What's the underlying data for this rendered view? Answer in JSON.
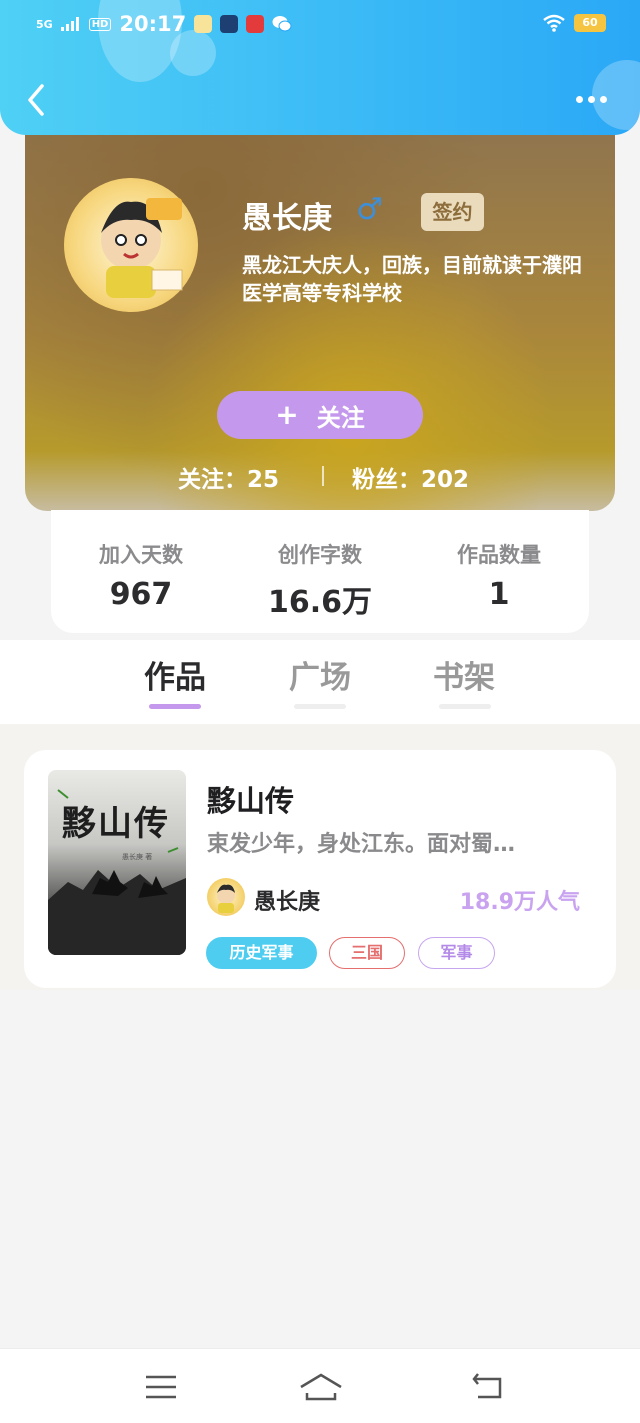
{
  "status_bar": {
    "network": "5G",
    "hd": "HD",
    "time": "20:17",
    "battery": "60",
    "colors": {
      "battery": "#f5c441"
    }
  },
  "header": {
    "back_icon": "chevron-left-icon",
    "more_icon": "more-horizontal-icon"
  },
  "profile": {
    "name": "愚长庚",
    "gender_symbol": "♂",
    "signed_badge": "签约",
    "bio": "黑龙江大庆人，回族，目前就读于濮阳医学高等专科学校",
    "follow_button": "关注",
    "follow_icon": "+",
    "following": "关注：25",
    "fans": "粉丝：202"
  },
  "stats": [
    {
      "label": "加入天数",
      "value": "967"
    },
    {
      "label": "创作字数",
      "value": "16.6万"
    },
    {
      "label": "作品数量",
      "value": "1"
    }
  ],
  "tabs": [
    {
      "label": "作品",
      "active": true
    },
    {
      "label": "广场",
      "active": false
    },
    {
      "label": "书架",
      "active": false
    }
  ],
  "book": {
    "cover_title": "黟山传",
    "cover_author": "愚长庚 著",
    "title": "黟山传",
    "description": "束发少年，身处江东。面对蜀…",
    "author": "愚长庚",
    "popularity": "18.9万人气",
    "tags": [
      "历史军事",
      "三国",
      "军事"
    ]
  },
  "bottom_nav": {
    "icons": [
      "menu-icon",
      "home-icon",
      "back-icon"
    ]
  },
  "colors": {
    "header_blue": "#2aa8f6",
    "accent_purple": "#c498ec",
    "tag_blue": "#4ecdf0",
    "tag_red": "#e56e6e"
  }
}
